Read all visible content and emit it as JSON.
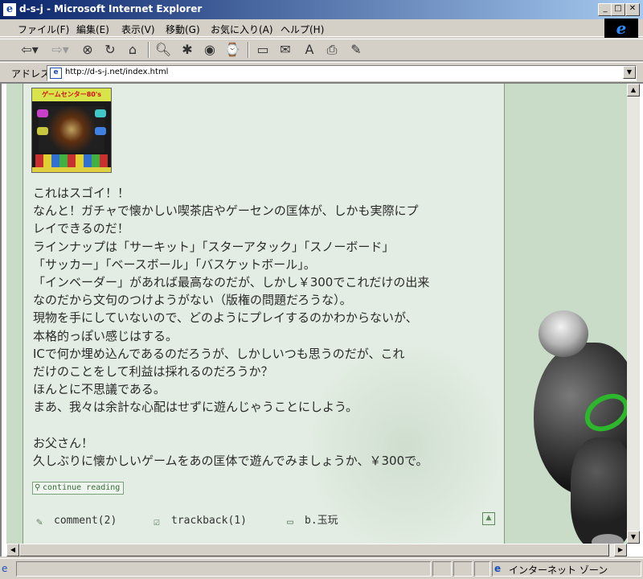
{
  "window": {
    "title": "d-s-j - Microsoft Internet Explorer"
  },
  "menu": [
    "ファイル(F)",
    "編集(E)",
    "表示(V)",
    "移動(G)",
    "お気に入り(A)",
    "ヘルプ(H)"
  ],
  "address": {
    "label": "アドレス",
    "url": "http://d-s-j.net/index.html"
  },
  "thumbnail": {
    "title_text": "ゲームセンター80's"
  },
  "post": {
    "lines": [
      "これはスゴイ！！",
      "なんと！ガチャで懐かしい喫茶店やゲーセンの匡体が、しかも実際にプ",
      "レイできるのだ！",
      "ラインナップは「サーキット」「スターアタック」「スノーボード」",
      "「サッカー」「ベースボール」「バスケットボール」。",
      "「インベーダー」があれば最高なのだが、しかし￥300でこれだけの出来",
      "なのだから文句のつけようがない（版権の問題だろうな）。",
      "現物を手にしていないので、どのようにプレイするのかわからないが、",
      "本格的っぽい感じはする。",
      "ICで何か埋め込んであるのだろうが、しかしいつも思うのだが、これ",
      "だけのことをして利益は採れるのだろうか？",
      "ほんとに不思議である。",
      "まあ、我々は余計な心配はせずに遊んじゃうことにしよう。"
    ],
    "closing_lines": [
      "お父さん！",
      "久しぶりに懐かしいゲームをあの匡体で遊んでみましょうか、￥300で。"
    ],
    "continue_label": "continue reading",
    "comment_label": "comment(2)",
    "trackback_label": "trackback(1)",
    "category_label": "b.玉玩"
  },
  "status": {
    "zone": "インターネット ゾーン"
  },
  "colors": {
    "page_bg": "#c8dcc8",
    "content_bg": "#e3ede3",
    "ring": "#2cb72c"
  }
}
